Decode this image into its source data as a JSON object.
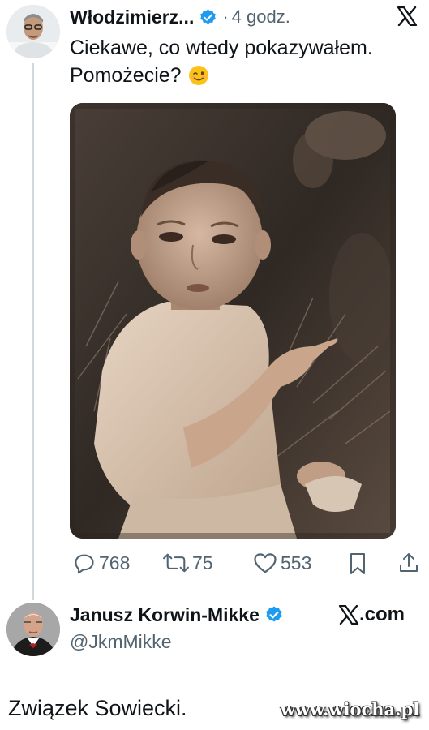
{
  "tweet": {
    "author_name": "Włodzimierz...",
    "time_separator": "·",
    "time": "4 godz.",
    "text_line1": "Ciekawe, co wtedy pokazywałem.",
    "text_line2": "Pomożecie?",
    "emoji": "😉",
    "stats": {
      "replies": "768",
      "reposts": "75",
      "likes": "553"
    }
  },
  "reply": {
    "author_name": "Janusz Korwin-Mikke",
    "handle": "@JkmMikke",
    "brand_suffix": ".com",
    "text": "Związek Sowiecki."
  },
  "watermark": "www.wiocha.pl",
  "colors": {
    "verified_blue": "#1d9bf0",
    "thread_line": "#cfd9de",
    "secondary_text": "#536471"
  },
  "icons": [
    "x-logo-icon",
    "verified-badge-icon",
    "reply-icon",
    "repost-icon",
    "like-icon",
    "bookmark-icon",
    "share-icon"
  ]
}
